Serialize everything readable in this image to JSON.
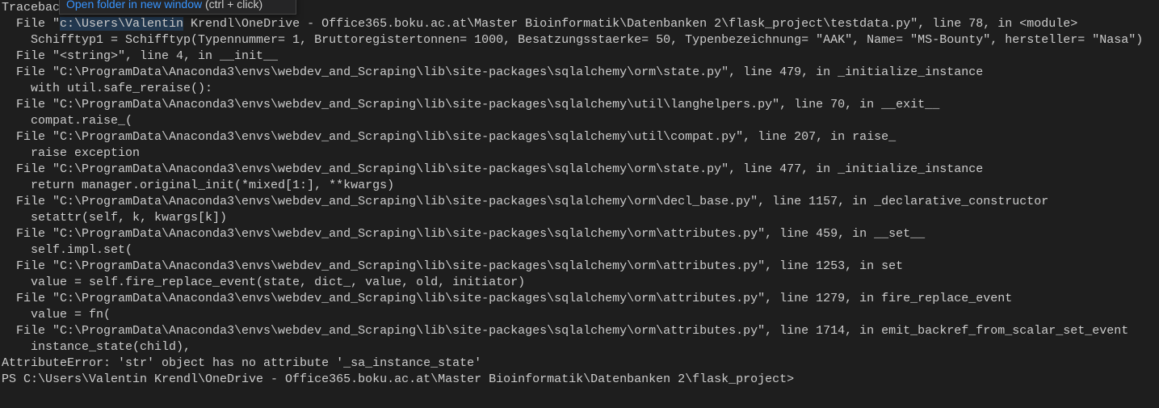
{
  "terminal": {
    "first_line": "Tracebac",
    "link_line": {
      "prefix": "  File \"",
      "link": "c:\\Users\\Valentin",
      "suffix": " Krendl\\OneDrive - Office365.boku.ac.at\\Master Bioinformatik\\Datenbanken 2\\flask_project\\testdata.py\", line 78, in <module>"
    },
    "lines": [
      "    Schifftyp1 = Schifftyp(Typennummer= 1, Bruttoregistertonnen= 1000, Besatzungsstaerke= 50, Typenbezeichnung= \"AAK\", Name= \"MS-Bounty\", hersteller= \"Nasa\")",
      "  File \"<string>\", line 4, in __init__",
      "  File \"C:\\ProgramData\\Anaconda3\\envs\\webdev_and_Scraping\\lib\\site-packages\\sqlalchemy\\orm\\state.py\", line 479, in _initialize_instance",
      "    with util.safe_reraise():",
      "  File \"C:\\ProgramData\\Anaconda3\\envs\\webdev_and_Scraping\\lib\\site-packages\\sqlalchemy\\util\\langhelpers.py\", line 70, in __exit__",
      "    compat.raise_(",
      "  File \"C:\\ProgramData\\Anaconda3\\envs\\webdev_and_Scraping\\lib\\site-packages\\sqlalchemy\\util\\compat.py\", line 207, in raise_",
      "    raise exception",
      "  File \"C:\\ProgramData\\Anaconda3\\envs\\webdev_and_Scraping\\lib\\site-packages\\sqlalchemy\\orm\\state.py\", line 477, in _initialize_instance",
      "    return manager.original_init(*mixed[1:], **kwargs)",
      "  File \"C:\\ProgramData\\Anaconda3\\envs\\webdev_and_Scraping\\lib\\site-packages\\sqlalchemy\\orm\\decl_base.py\", line 1157, in _declarative_constructor",
      "    setattr(self, k, kwargs[k])",
      "  File \"C:\\ProgramData\\Anaconda3\\envs\\webdev_and_Scraping\\lib\\site-packages\\sqlalchemy\\orm\\attributes.py\", line 459, in __set__",
      "    self.impl.set(",
      "  File \"C:\\ProgramData\\Anaconda3\\envs\\webdev_and_Scraping\\lib\\site-packages\\sqlalchemy\\orm\\attributes.py\", line 1253, in set",
      "    value = self.fire_replace_event(state, dict_, value, old, initiator)",
      "  File \"C:\\ProgramData\\Anaconda3\\envs\\webdev_and_Scraping\\lib\\site-packages\\sqlalchemy\\orm\\attributes.py\", line 1279, in fire_replace_event",
      "    value = fn(",
      "  File \"C:\\ProgramData\\Anaconda3\\envs\\webdev_and_Scraping\\lib\\site-packages\\sqlalchemy\\orm\\attributes.py\", line 1714, in emit_backref_from_scalar_set_event",
      "    instance_state(child),",
      "AttributeError: 'str' object has no attribute '_sa_instance_state'"
    ],
    "prompt": "PS C:\\Users\\Valentin Krendl\\OneDrive - Office365.boku.ac.at\\Master Bioinformatik\\Datenbanken 2\\flask_project>"
  },
  "tooltip": {
    "action": "Open folder in new window",
    "hint": "(ctrl + click)"
  }
}
